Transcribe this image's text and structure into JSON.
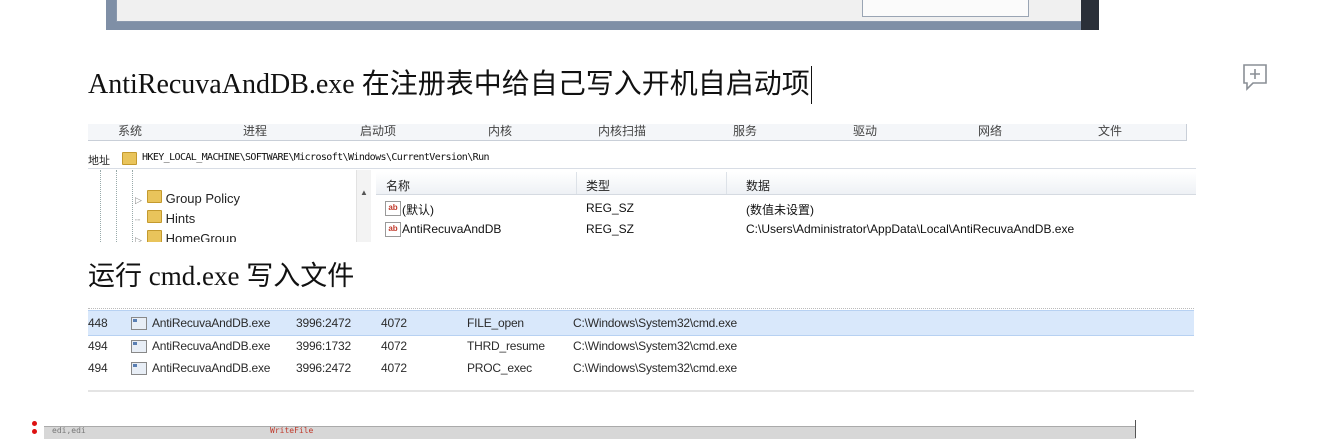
{
  "heading_registry": "AntiRecuvaAndDB.exe 在注册表中给自己写入开机自启动项",
  "heading_cmd": "运行 cmd.exe 写入文件",
  "registry": {
    "toolbar": [
      "系统",
      "进程",
      "启动项",
      "内核",
      "内核扫描",
      "服务",
      "驱动",
      "网络",
      "文件"
    ],
    "address_label": "地址",
    "address_path": "HKEY_LOCAL_MACHINE\\SOFTWARE\\Microsoft\\Windows\\CurrentVersion\\Run",
    "tree_items": [
      {
        "label": "Group Policy",
        "expandable": true
      },
      {
        "label": "Hints",
        "expandable": false
      },
      {
        "label": "HomeGroup",
        "expandable": true
      }
    ],
    "columns": [
      "名称",
      "类型",
      "数据"
    ],
    "rows": [
      {
        "name": "(默认)",
        "type": "REG_SZ",
        "data": "(数值未设置)"
      },
      {
        "name": "AntiRecuvaAndDB",
        "type": "REG_SZ",
        "data": "C:\\Users\\Administrator\\AppData\\Local\\AntiRecuvaAndDB.exe"
      }
    ]
  },
  "procmon": {
    "rows": [
      {
        "seq": "448",
        "process": "AntiRecuvaAndDB.exe",
        "pid_tid": "3996:2472",
        "tid": "4072",
        "event": "FILE_open",
        "path": "C:\\Windows\\System32\\cmd.exe",
        "selected": true
      },
      {
        "seq": "494",
        "process": "AntiRecuvaAndDB.exe",
        "pid_tid": "3996:1732",
        "tid": "4072",
        "event": "THRD_resume",
        "path": "C:\\Windows\\System32\\cmd.exe",
        "selected": false
      },
      {
        "seq": "494",
        "process": "AntiRecuvaAndDB.exe",
        "pid_tid": "3996:2472",
        "tid": "4072",
        "event": "PROC_exec",
        "path": "C:\\Windows\\System32\\cmd.exe",
        "selected": false
      }
    ]
  },
  "disasm": {
    "left_text": "edi,edi",
    "mid_text": "WriteFile"
  },
  "colors": {
    "selection": "#d9e8fb",
    "folder": "#e9c45b",
    "frame": "#7f8fa6"
  },
  "icons": {
    "comment": "add-comment-icon"
  }
}
